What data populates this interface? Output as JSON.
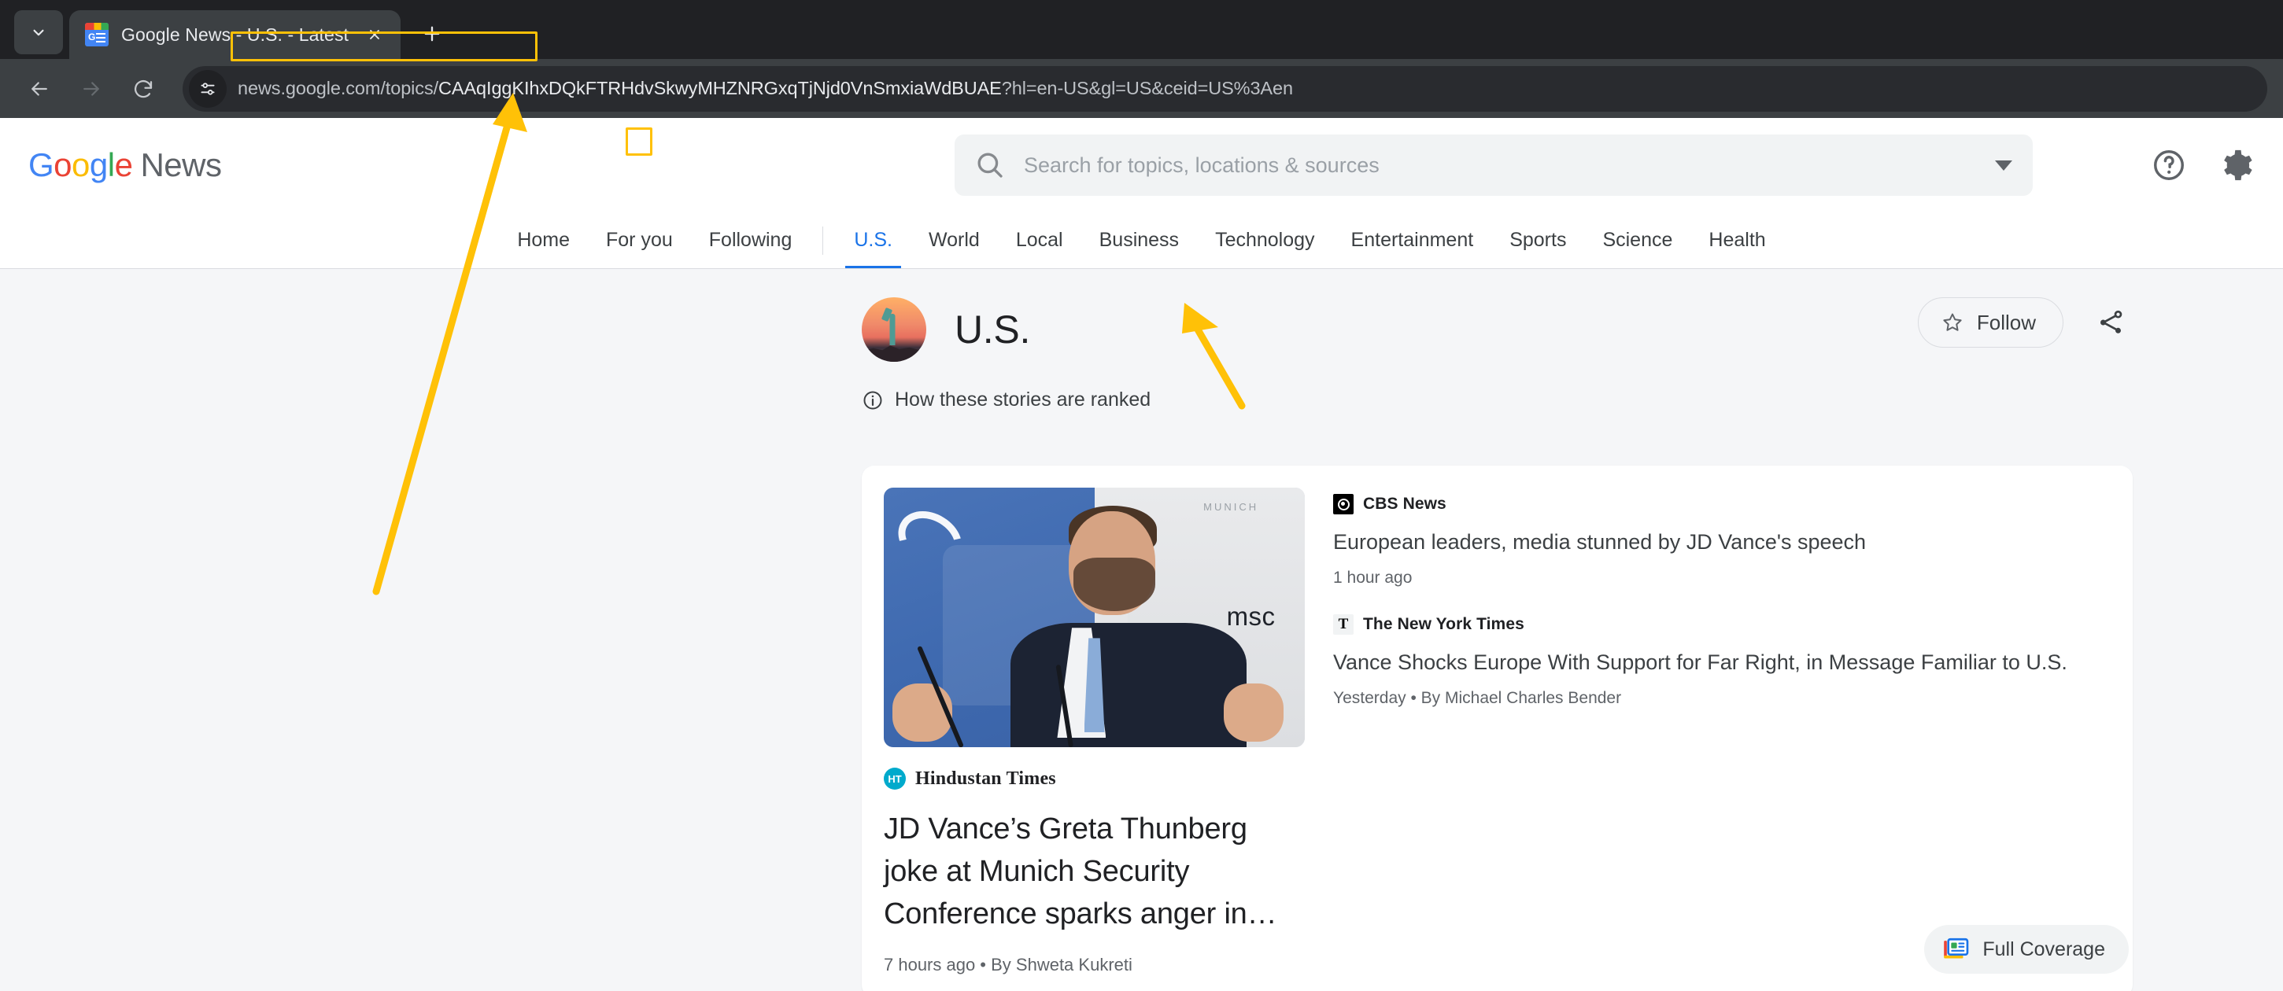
{
  "browser": {
    "tab": {
      "title": "Google News - U.S. - Latest",
      "favicon_letter": "G",
      "favicon_name": "google-news-favicon"
    },
    "new_tab_label": "+",
    "url": {
      "prefix": "news.google.com/topics/",
      "highlighted_segment": "CAAqIggKIhxDQkFTRHdvSkwyMHZNRGxqTjNjd0VnSmxiaWdBUAE",
      "query": "?hl=en-US&gl=US&ceid=US%3Aen",
      "full": "news.google.com/topics/CAAqIggKIhxDQkFTRHdvSkwyMHZNRGxqTjNjd0VnSmxiaWdBUAE?hl=en-US&gl=US&ceid=US%3Aen"
    },
    "icons": {
      "back": "back-arrow-icon",
      "forward": "forward-arrow-icon",
      "reload": "reload-icon",
      "site_info": "site-settings-icon"
    }
  },
  "annotations": {
    "accent_color": "#FFC107",
    "url_box_label": "topic-id-highlight",
    "tab_box_label": "us-tab-highlight"
  },
  "header": {
    "logo": {
      "g1": "G",
      "o1": "o",
      "o2": "o",
      "g2": "g",
      "l": "l",
      "e": "e",
      "word": "News"
    },
    "search": {
      "placeholder": "Search for topics, locations & sources",
      "value": ""
    },
    "help_icon": "help-circle-icon",
    "settings_icon": "gear-icon"
  },
  "nav": {
    "items": [
      {
        "label": "Home",
        "active": false
      },
      {
        "label": "For you",
        "active": false
      },
      {
        "label": "Following",
        "active": false
      },
      {
        "label": "U.S.",
        "active": true
      },
      {
        "label": "World",
        "active": false
      },
      {
        "label": "Local",
        "active": false
      },
      {
        "label": "Business",
        "active": false
      },
      {
        "label": "Technology",
        "active": false
      },
      {
        "label": "Entertainment",
        "active": false
      },
      {
        "label": "Sports",
        "active": false
      },
      {
        "label": "Science",
        "active": false
      },
      {
        "label": "Health",
        "active": false
      }
    ],
    "active_color": "#1a73e8"
  },
  "topic": {
    "title": "U.S.",
    "avatar_name": "statue-of-liberty-avatar",
    "follow_label": "Follow",
    "share_label": "share-icon",
    "ranked_note": "How these stories are ranked",
    "info_icon": "info-icon"
  },
  "story": {
    "lead": {
      "source": "Hindustan Times",
      "source_logo": "HT",
      "title": "JD Vance’s Greta Thunberg joke at Munich Security Conference sparks anger in…",
      "time": "7 hours ago",
      "byline": "By Shweta Kukreti",
      "meta": "7 hours ago • By Shweta Kukreti",
      "image_alt": "JD Vance speaking at Munich Security Conference",
      "image_caption_msc": "msc",
      "image_caption_munich": "MUNICH"
    },
    "related": [
      {
        "source": "CBS News",
        "logo": "cbs-eye-icon",
        "title": "European leaders, media stunned by JD Vance's speech",
        "meta": "1 hour ago"
      },
      {
        "source": "The New York Times",
        "logo": "nyt-t-icon",
        "title": "Vance Shocks Europe With Support for Far Right, in Message Familiar to U.S.",
        "meta": "Yesterday • By Michael Charles Bender"
      }
    ],
    "full_coverage_label": "Full Coverage",
    "full_coverage_icon": "full-coverage-icon"
  }
}
